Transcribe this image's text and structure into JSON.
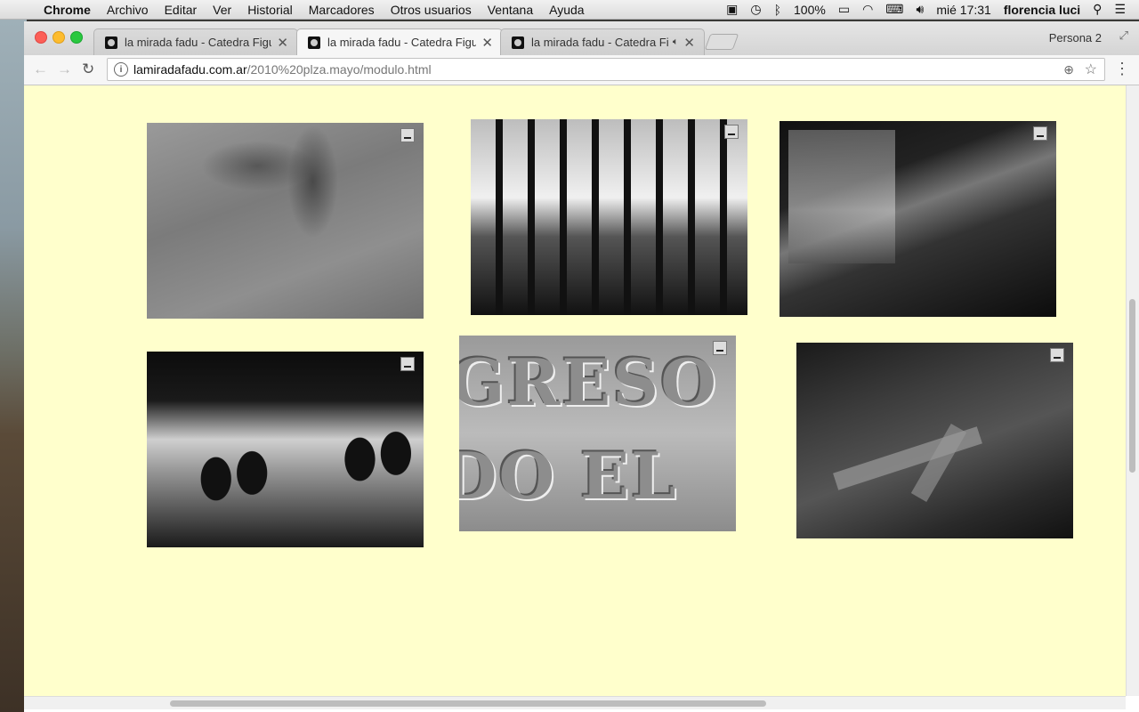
{
  "menubar": {
    "apple_icon": "apple-icon",
    "app_name": "Chrome",
    "items": [
      "Archivo",
      "Editar",
      "Ver",
      "Historial",
      "Marcadores",
      "Otros usuarios",
      "Ventana",
      "Ayuda"
    ],
    "battery": "100%",
    "clock": "mié 17:31",
    "user": "florencia luci"
  },
  "browser": {
    "tabs": [
      {
        "title": "la mirada fadu - Catedra Figu",
        "state": "inactive"
      },
      {
        "title": "la mirada fadu - Catedra Figu",
        "state": "active"
      },
      {
        "title": "la mirada fadu - Catedra Fi",
        "state": "inactive",
        "audio": true
      }
    ],
    "profile": "Persona 2",
    "url": {
      "host": "lamiradafadu.com.ar",
      "path": "/2010%20plza.mayo/modulo.html"
    }
  },
  "page": {
    "background": "#ffffcc",
    "photos": [
      {
        "subject": "puddle reflection"
      },
      {
        "subject": "iron gate against sky"
      },
      {
        "subject": "wet street reflection"
      },
      {
        "subject": "shadows of people on wall"
      },
      {
        "subject": "engraved letters",
        "text_line1": "GRESO",
        "text_line2": "DO EL"
      },
      {
        "subject": "road arrows"
      }
    ]
  }
}
